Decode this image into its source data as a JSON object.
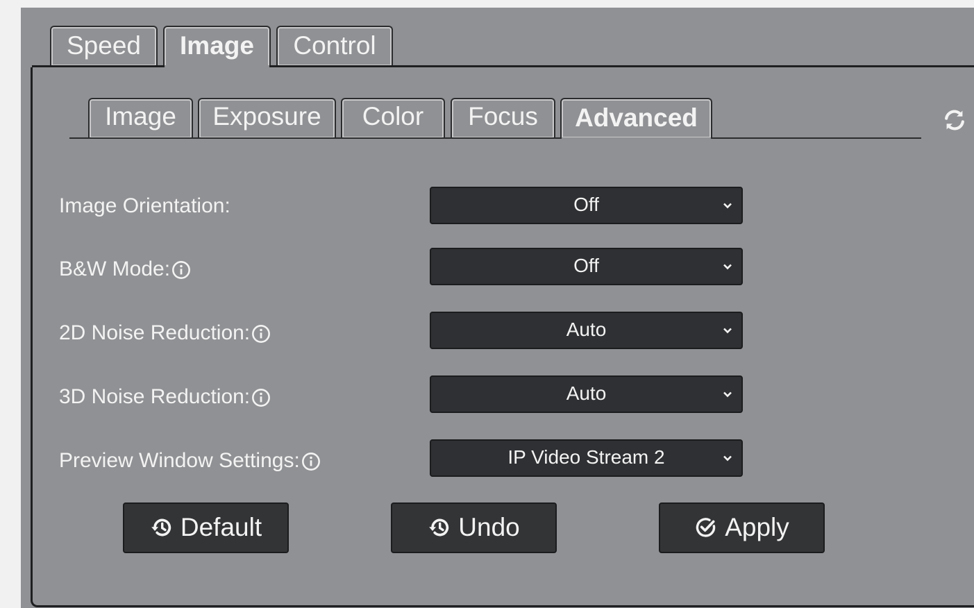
{
  "top_tabs": [
    {
      "label": "Speed",
      "active": false
    },
    {
      "label": "Image",
      "active": true
    },
    {
      "label": "Control",
      "active": false
    }
  ],
  "sub_tabs": [
    {
      "label": "Image",
      "active": false
    },
    {
      "label": "Exposure",
      "active": false
    },
    {
      "label": "Color",
      "active": false
    },
    {
      "label": "Focus",
      "active": false
    },
    {
      "label": "Advanced",
      "active": true
    }
  ],
  "settings": [
    {
      "label": "Image Orientation:",
      "value": "Off",
      "info": false
    },
    {
      "label": "B&W Mode:",
      "value": "Off",
      "info": true
    },
    {
      "label": "2D Noise Reduction:",
      "value": "Auto",
      "info": true
    },
    {
      "label": "3D Noise Reduction:",
      "value": "Auto",
      "info": true
    },
    {
      "label": "Preview Window Settings:",
      "value": "IP Video Stream 2",
      "info": true
    }
  ],
  "buttons": {
    "default_label": "Default",
    "undo_label": "Undo",
    "apply_label": "Apply"
  },
  "icons": {
    "refresh": "refresh-icon",
    "info": "info-icon",
    "history": "history-icon",
    "check": "check-circle-icon",
    "dropdown": "chevron-down-icon"
  },
  "colors": {
    "panel_bg": "#909194",
    "control_bg": "#2f3033",
    "text": "#f3f3f3"
  }
}
